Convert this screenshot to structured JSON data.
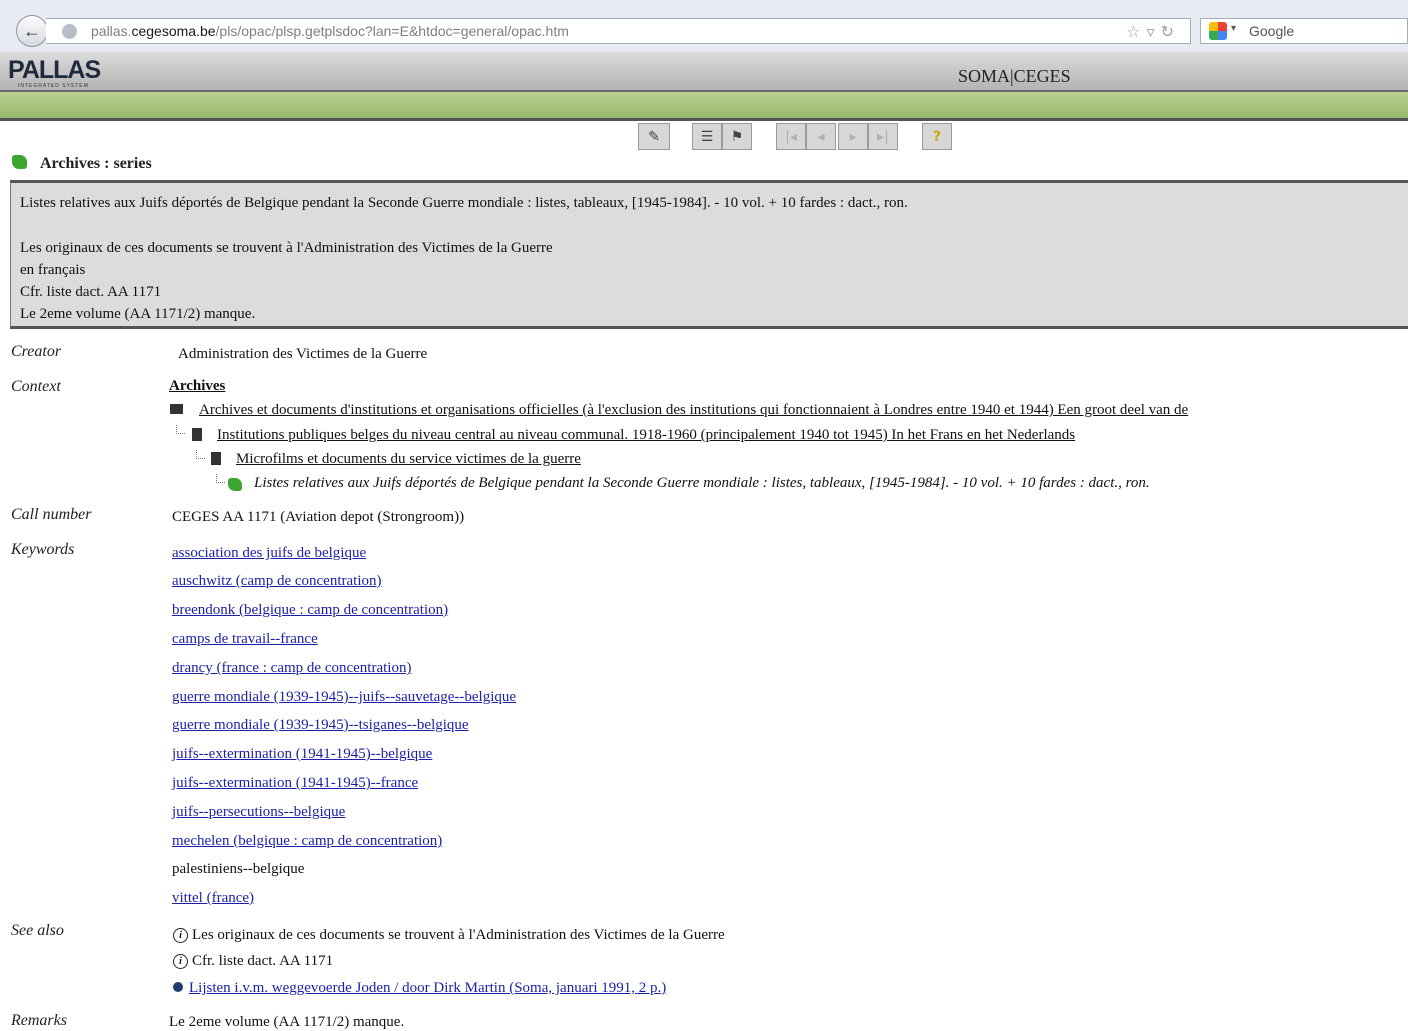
{
  "browser": {
    "url_prefix": "pallas.",
    "url_domain": "cegesoma.be",
    "url_path": "/pls/opac/plsp.getplsdoc?lan=E&htdoc=general/opac.htm",
    "search_placeholder": "Google",
    "back_glyph": "←"
  },
  "header": {
    "logo": "PALLAS",
    "logo_sub": "INTEGRATED SYSTEM",
    "brand": "SOMA|CEGES"
  },
  "toolbar": {
    "icons": [
      "edit-icon",
      "list-icon",
      "hierarchy-icon",
      "first-icon",
      "prev-icon",
      "next-icon",
      "last-icon",
      "help-icon"
    ],
    "glyphs": [
      "✎",
      "☰",
      "⚑",
      "|◂",
      "◂",
      "▸",
      "▸|",
      "?"
    ]
  },
  "record": {
    "section_title": "Archives : series",
    "description": {
      "title": "Listes relatives aux Juifs déportés de Belgique pendant la Seconde Guerre mondiale : listes, tableaux, [1945-1984]. - 10 vol. + 10 fardes : dact., ron.",
      "note1": "Les originaux de ces documents se trouvent à l'Administration des Victimes de la Guerre",
      "note2": "en français",
      "note3": "Cfr. liste dact. AA 1171",
      "note4": "Le 2eme volume (AA 1171/2) manque."
    },
    "creator_label": "Creator",
    "creator": "Administration des Victimes de la Guerre",
    "context_label": "Context",
    "context": {
      "root": "Archives",
      "level1": "Archives et documents d'institutions et organisations officielles (à l'exclusion des institutions qui fonctionnaient à Londres entre 1940 et 1944) Een groot deel van de",
      "level2": "Institutions publiques belges du niveau central au niveau communal. 1918-1960 (principalement 1940 tot 1945) In het Frans en het Nederlands",
      "level3": "Microfilms et documents du service victimes de la guerre",
      "level4": "Listes relatives aux Juifs déportés de Belgique pendant la Seconde Guerre mondiale : listes, tableaux, [1945-1984]. - 10 vol. + 10 fardes : dact., ron."
    },
    "callnumber_label": "Call number",
    "callnumber": "CEGES AA 1171 (Aviation depot (Strongroom))",
    "keywords_label": "Keywords",
    "keywords": [
      "association des juifs de belgique",
      "auschwitz (camp de concentration)",
      "breendonk (belgique : camp de concentration)",
      "camps de travail--france",
      "drancy (france : camp de concentration)",
      "guerre mondiale (1939-1945)--juifs--sauvetage--belgique",
      "guerre mondiale (1939-1945)--tsiganes--belgique",
      "juifs--extermination (1941-1945)--belgique",
      "juifs--extermination (1941-1945)--france",
      "juifs--persecutions--belgique",
      "mechelen (belgique : camp de concentration)",
      "palestiniens--belgique",
      "vittel (france)"
    ],
    "seealso_label": "See also",
    "seealso": {
      "note1": "Les originaux de ces documents se trouvent à l'Administration des Victimes de la Guerre",
      "note2": "Cfr. liste dact. AA 1171",
      "link": "Lijsten i.v.m. weggevoerde Joden / door Dirk Martin (Soma, januari 1991, 2 p.)"
    },
    "remarks_label": "Remarks",
    "remarks": "Le 2eme volume (AA 1171/2) manque."
  }
}
